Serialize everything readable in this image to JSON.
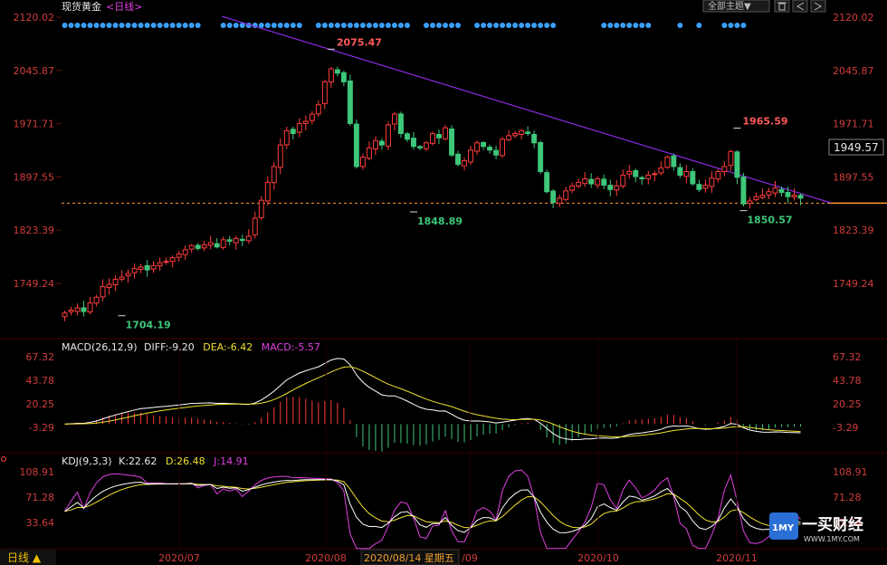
{
  "header": {
    "instrument": "现货黄金",
    "period_label": "<日线>",
    "theme_button": "全部主题▼",
    "toolbar_icons": [
      "trash-icon",
      "back-icon",
      "forward-icon"
    ]
  },
  "footer": {
    "period_button": "日线 ▲",
    "cursor_date": "2020/08/14 星期五"
  },
  "logo": {
    "badge": "1MY",
    "name": "一买财经",
    "url": "WWW.1MY.COM"
  },
  "colors": {
    "up": "#ff3b3b",
    "down": "#3ec77a",
    "axis_text": "#d23c3c",
    "trendline": "#8a2be2",
    "support": "#ff9933",
    "diff": "#ffffff",
    "dea": "#f0e030",
    "macd_label": "#e040e0",
    "dots": "#3aa0ff"
  },
  "chart_data": [
    {
      "type": "candlestick",
      "title": "现货黄金 <日线>",
      "y_ticks": [
        "2120.02",
        "2045.87",
        "1971.71",
        "1897.55",
        "1823.39",
        "1749.24"
      ],
      "ylim": [
        1690,
        2120.02
      ],
      "x_ticks": [
        "2020/07",
        "2020/08",
        "/09",
        "2020/10",
        "2020/11"
      ],
      "current_price": "1949.57",
      "support_level": 1861,
      "annotations": [
        {
          "label": "2075.47",
          "kind": "high"
        },
        {
          "label": "1704.19",
          "kind": "low"
        },
        {
          "label": "1848.89",
          "kind": "low"
        },
        {
          "label": "1965.59",
          "kind": "high"
        },
        {
          "label": "1850.57",
          "kind": "low"
        }
      ],
      "closes": [
        1708,
        1712,
        1715,
        1710,
        1722,
        1730,
        1745,
        1748,
        1755,
        1758,
        1763,
        1770,
        1772,
        1768,
        1774,
        1778,
        1780,
        1785,
        1790,
        1796,
        1802,
        1798,
        1803,
        1806,
        1800,
        1810,
        1808,
        1812,
        1809,
        1815,
        1840,
        1865,
        1890,
        1912,
        1942,
        1962,
        1958,
        1972,
        1975,
        1985,
        1998,
        2030,
        2048,
        2042,
        2030,
        1972,
        1912,
        1925,
        1938,
        1948,
        1942,
        1970,
        1985,
        1958,
        1950,
        1940,
        1938,
        1945,
        1958,
        1952,
        1966,
        1928,
        1915,
        1920,
        1935,
        1945,
        1940,
        1935,
        1928,
        1950,
        1955,
        1958,
        1962,
        1958,
        1945,
        1905,
        1877,
        1862,
        1868,
        1878,
        1885,
        1890,
        1895,
        1888,
        1895,
        1886,
        1880,
        1885,
        1900,
        1905,
        1898,
        1895,
        1900,
        1902,
        1910,
        1925,
        1912,
        1900,
        1905,
        1888,
        1880,
        1886,
        1896,
        1905,
        1912,
        1933,
        1897,
        1860,
        1864,
        1870,
        1872,
        1877,
        1882,
        1876,
        1870,
        1872,
        1868
      ]
    },
    {
      "type": "line",
      "title": "MACD(26,12,9)",
      "series": [
        {
          "name": "DIFF",
          "last": "-9.20"
        },
        {
          "name": "DEA",
          "last": "-6.42"
        },
        {
          "name": "MACD",
          "last": "-5.57"
        }
      ],
      "y_ticks": [
        "67.32",
        "43.78",
        "20.25",
        "-3.29"
      ]
    },
    {
      "type": "line",
      "title": "KDJ(9,3,3)",
      "series": [
        {
          "name": "K",
          "last": "22.62"
        },
        {
          "name": "D",
          "last": "26.48"
        },
        {
          "name": "J",
          "last": "14.91"
        }
      ],
      "y_ticks": [
        "108.91",
        "71.28",
        "33.64"
      ]
    }
  ]
}
